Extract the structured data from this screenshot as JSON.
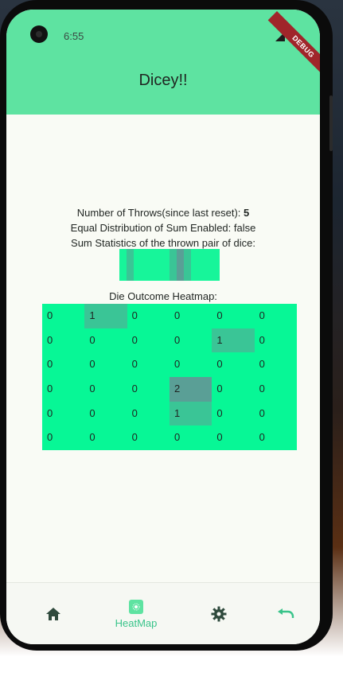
{
  "status": {
    "time": "6:55",
    "debug_banner": "DEBUG"
  },
  "app": {
    "title": "Dicey!!"
  },
  "stats": {
    "throws_label": "Number of Throws(since last reset):",
    "throws_value": "5",
    "equal_distribution": "Equal Distribution of Sum Enabled: false",
    "sum_statistics_label": "Sum Statistics of the thrown pair of dice:"
  },
  "sum_bar": {
    "colors": [
      "#17f59a",
      "#3ac596",
      "#17f59a",
      "#17f59a",
      "#3ac596",
      "#5a9f96",
      "#3ac596",
      "#17f59a",
      "#17f59a"
    ],
    "weights": [
      1,
      1,
      4,
      1,
      1,
      1,
      1,
      1,
      3
    ]
  },
  "heatmap": {
    "title": "Die Outcome Heatmap:",
    "rows": [
      [
        "0",
        "1",
        "0",
        "0",
        "0",
        "0"
      ],
      [
        "0",
        "0",
        "0",
        "0",
        "1",
        "0"
      ],
      [
        "0",
        "0",
        "0",
        "0",
        "0",
        "0"
      ],
      [
        "0",
        "0",
        "0",
        "2",
        "0",
        "0"
      ],
      [
        "0",
        "0",
        "0",
        "1",
        "0",
        "0"
      ],
      [
        "0",
        "0",
        "0",
        "0",
        "0",
        "0"
      ]
    ],
    "colors": {
      "0": "#07f796",
      "1": "#3ac596",
      "2": "#5a9f96"
    }
  },
  "nav": {
    "items": [
      {
        "name": "home",
        "icon": "home-icon",
        "label": ""
      },
      {
        "name": "heatmap",
        "icon": "heatmap-icon",
        "label": "HeatMap",
        "active": true
      },
      {
        "name": "settings",
        "icon": "gear-icon",
        "label": ""
      },
      {
        "name": "reset",
        "icon": "undo-icon",
        "label": ""
      }
    ],
    "colors": {
      "active": "#39c48a",
      "inactive": "#2f4a3c"
    }
  }
}
